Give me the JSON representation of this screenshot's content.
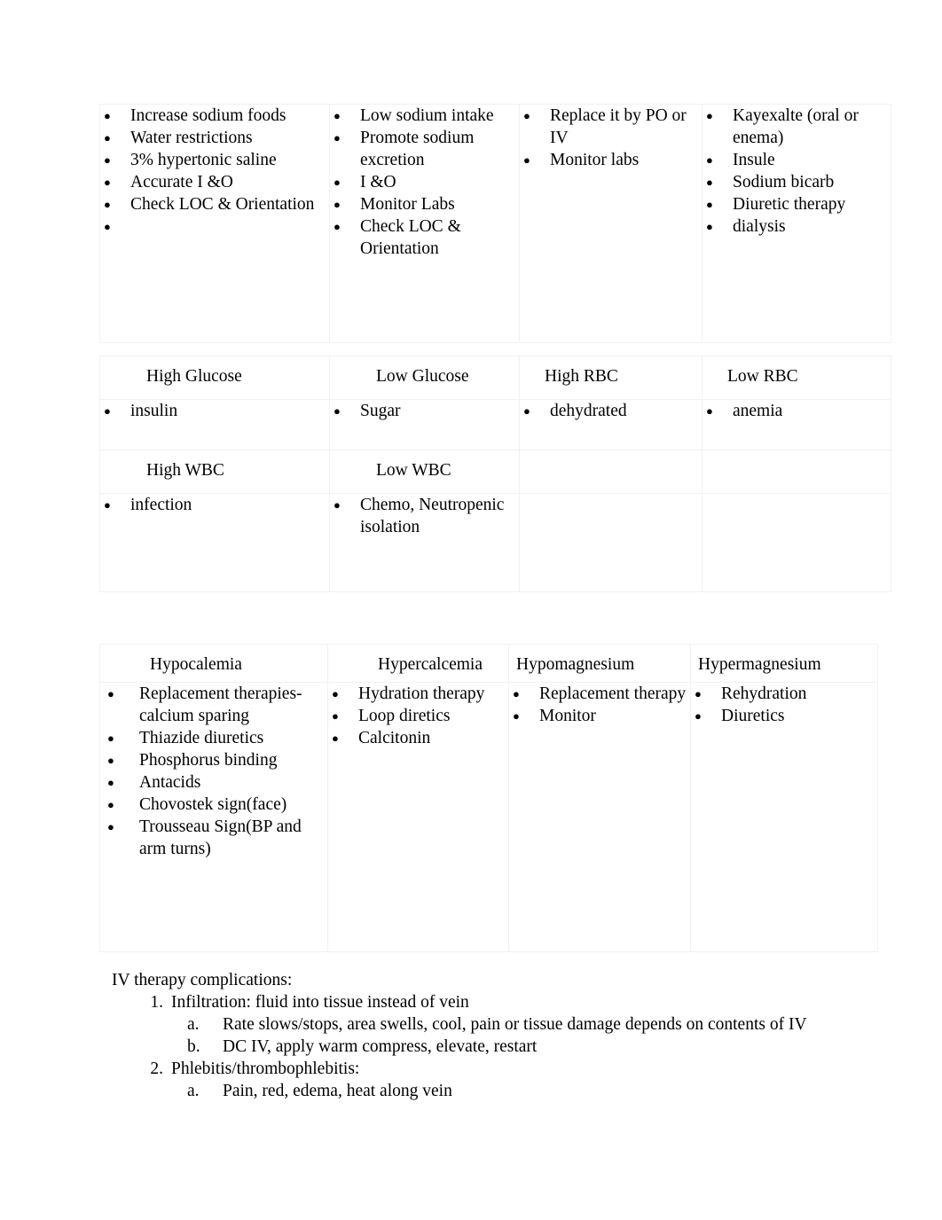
{
  "document": {
    "bullet_glyph": "●"
  },
  "table_one": {
    "columns": [
      {
        "name": "hyponatremia-interventions",
        "items": [
          "Increase sodium foods",
          "Water restrictions",
          "3% hypertonic saline",
          "Accurate   I &O",
          "Check LOC & Orientation",
          ""
        ]
      },
      {
        "name": "hypernatremia-interventions",
        "items": [
          "Low sodium intake",
          "Promote sodium excretion",
          "I &O",
          "Monitor Labs",
          "Check LOC & Orientation"
        ]
      },
      {
        "name": "hypokalemia-interventions",
        "items": [
          "Replace it by PO or IV",
          "Monitor labs"
        ]
      },
      {
        "name": "hyperkalemia-interventions",
        "items": [
          "Kayexalte (oral or enema)",
          "Insule",
          "Sodium bicarb",
          "Diuretic therapy",
          "dialysis"
        ]
      }
    ]
  },
  "table_two": {
    "header_row_one": [
      "High Glucose",
      "Low Glucose",
      "High RBC",
      "Low RBC"
    ],
    "body_row_one": [
      [
        "insulin"
      ],
      [
        "Sugar"
      ],
      [
        "dehydrated"
      ],
      [
        "anemia"
      ]
    ],
    "header_row_two": [
      "High WBC",
      "Low WBC",
      "",
      ""
    ],
    "body_row_two": [
      [
        "infection"
      ],
      [
        "Chemo, Neutropenic isolation"
      ],
      [],
      []
    ]
  },
  "table_three": {
    "headers": [
      "Hypocalemia",
      "Hypercalcemia",
      "Hypomagnesium",
      "Hypermagnesium"
    ],
    "body": [
      [
        "Replacement therapies-calcium sparing",
        "Thiazide diuretics",
        "Phosphorus binding",
        "Antacids",
        "Chovostek sign(face)",
        "Trousseau Sign(BP and arm turns)"
      ],
      [
        "Hydration therapy",
        "Loop diretics",
        "Calcitonin"
      ],
      [
        "Replacement therapy",
        "Monitor"
      ],
      [
        "Rehydration",
        "Diuretics"
      ]
    ]
  },
  "iv_section": {
    "heading": "IV therapy complications:",
    "items": [
      {
        "marker": "1.",
        "text": "Infiltration: fluid into tissue instead of vein",
        "sub": [
          {
            "marker": "a.",
            "text": "Rate slows/stops, area swells, cool, pain or tissue damage depends on contents of IV"
          },
          {
            "marker": "b.",
            "text": "DC IV, apply warm compress, elevate, restart"
          }
        ]
      },
      {
        "marker": "2.",
        "text": "Phlebitis/thrombophlebitis:",
        "sub": [
          {
            "marker": "a.",
            "text": "Pain, red, edema, heat along vein"
          }
        ]
      }
    ]
  }
}
